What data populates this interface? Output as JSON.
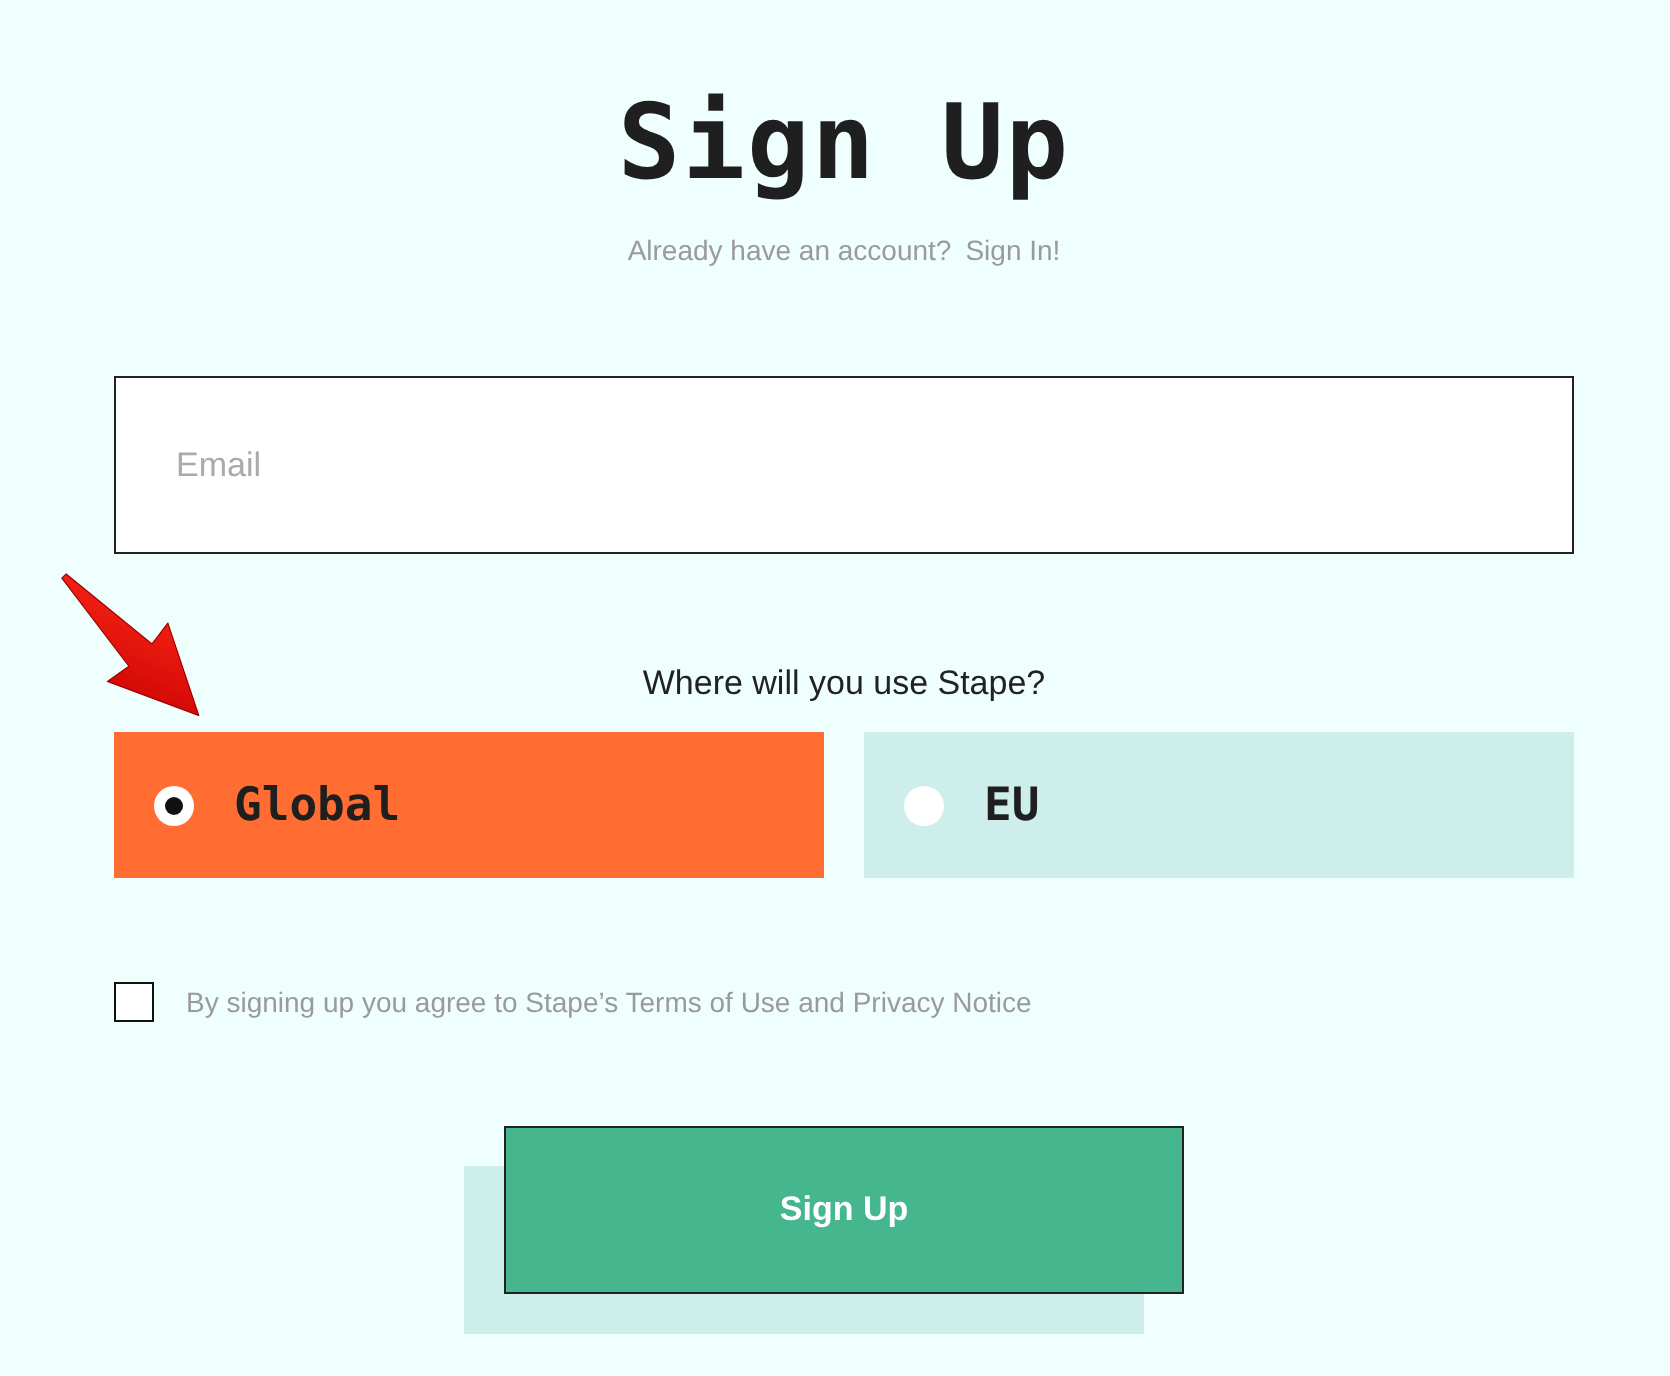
{
  "title": "Sign Up",
  "signin_prompt": {
    "text": "Already have an account?",
    "link": "Sign In!"
  },
  "email": {
    "placeholder": "Email"
  },
  "region": {
    "question": "Where will you use Stape?",
    "options": [
      {
        "label": "Global",
        "selected": true
      },
      {
        "label": "EU",
        "selected": false
      }
    ]
  },
  "terms": {
    "checked": false,
    "text": "By signing up you agree to Stape’s Terms of Use and Privacy Notice"
  },
  "submit": {
    "label": "Sign Up"
  }
}
